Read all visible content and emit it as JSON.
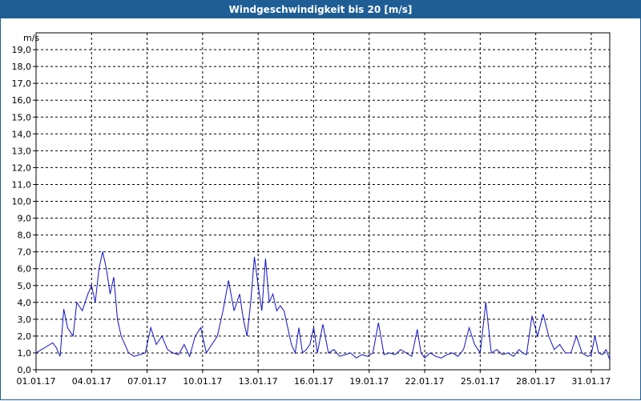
{
  "title": "Windgeschwindigkeit bis 20 [m/s]",
  "chart_data": {
    "type": "line",
    "ylabel": "m/s",
    "xlabel": "",
    "ylim": [
      0,
      20
    ],
    "xlim": [
      0,
      31
    ],
    "grid": true,
    "y_ticks": [
      "0,0",
      "1,0",
      "2,0",
      "3,0",
      "4,0",
      "5,0",
      "6,0",
      "7,0",
      "8,0",
      "9,0",
      "10,0",
      "11,0",
      "12,0",
      "13,0",
      "14,0",
      "15,0",
      "16,0",
      "17,0",
      "18,0",
      "19,0"
    ],
    "x_ticks": [
      "01.01.17",
      "04.01.17",
      "07.01.17",
      "10.01.17",
      "13.01.17",
      "16.01.17",
      "19.01.17",
      "22.01.17",
      "25.01.17",
      "28.01.17",
      "31.01.17"
    ],
    "x_tick_days": [
      0,
      3,
      6,
      9,
      12,
      15,
      18,
      21,
      24,
      27,
      30
    ],
    "colors": {
      "series": "#1010c8",
      "title_bar": "#1e5e95",
      "grid": "#000000"
    },
    "series": [
      {
        "x": [
          0,
          0.3,
          0.6,
          0.9,
          1.1,
          1.3,
          1.5,
          1.7,
          2.0,
          2.2,
          2.5,
          2.8,
          3.0,
          3.2,
          3.4,
          3.6,
          3.8,
          4.0,
          4.2,
          4.4,
          4.6,
          4.8,
          5.0,
          5.3,
          5.6,
          5.9,
          6.2,
          6.5,
          6.8,
          7.1,
          7.4,
          7.7,
          8.0,
          8.3,
          8.6,
          8.9,
          9.2,
          9.5,
          9.8,
          10.1,
          10.4,
          10.7,
          11.0,
          11.2,
          11.4,
          11.6,
          11.8,
          12.0,
          12.2,
          12.4,
          12.6,
          12.8,
          13.0,
          13.2,
          13.4,
          13.6,
          13.8,
          14.0,
          14.2,
          14.4,
          14.6,
          14.8,
          15.0,
          15.2,
          15.5,
          15.8,
          16.1,
          16.4,
          16.7,
          17.0,
          17.3,
          17.6,
          17.9,
          18.2,
          18.5,
          18.8,
          19.1,
          19.4,
          19.7,
          20.0,
          20.3,
          20.6,
          20.8,
          21.0,
          21.3,
          21.6,
          21.9,
          22.2,
          22.5,
          22.8,
          23.1,
          23.4,
          23.7,
          24.0,
          24.3,
          24.6,
          24.9,
          25.2,
          25.5,
          25.8,
          26.1,
          26.3,
          26.5,
          26.8,
          27.1,
          27.4,
          27.7,
          28.0,
          28.3,
          28.6,
          28.9,
          29.2,
          29.5,
          29.8,
          30.0,
          30.2,
          30.4,
          30.6,
          30.8,
          31.0
        ],
        "y": [
          1.0,
          1.2,
          1.4,
          1.6,
          1.3,
          0.8,
          3.6,
          2.5,
          2.0,
          4.0,
          3.5,
          4.5,
          5.0,
          4.0,
          6.0,
          7.0,
          6.0,
          4.5,
          5.5,
          3.0,
          2.0,
          1.5,
          1.0,
          0.8,
          0.9,
          1.0,
          2.5,
          1.5,
          2.0,
          1.2,
          1.0,
          0.9,
          1.5,
          0.8,
          2.0,
          2.5,
          1.0,
          1.5,
          2.0,
          3.5,
          5.3,
          3.5,
          4.5,
          3.0,
          2.0,
          4.0,
          6.7,
          5.0,
          3.5,
          6.6,
          4.0,
          4.5,
          3.5,
          3.8,
          3.5,
          2.5,
          1.5,
          1.0,
          2.5,
          1.0,
          1.2,
          1.5,
          2.5,
          1.0,
          2.7,
          1.0,
          1.2,
          0.8,
          0.9,
          1.0,
          0.7,
          0.9,
          0.8,
          1.0,
          2.8,
          0.9,
          1.0,
          0.9,
          1.2,
          1.0,
          0.8,
          2.4,
          1.0,
          0.7,
          1.0,
          0.8,
          0.7,
          0.9,
          1.0,
          0.8,
          1.2,
          2.5,
          1.5,
          1.0,
          4.0,
          1.0,
          1.2,
          0.9,
          1.0,
          0.8,
          1.2,
          1.0,
          0.9,
          3.2,
          2.0,
          3.3,
          2.0,
          1.2,
          1.5,
          1.0,
          1.0,
          2.0,
          1.0,
          0.8,
          0.9,
          2.0,
          1.0,
          0.9,
          1.2,
          0.6
        ],
        "_note_ignore": ""
      }
    ]
  }
}
